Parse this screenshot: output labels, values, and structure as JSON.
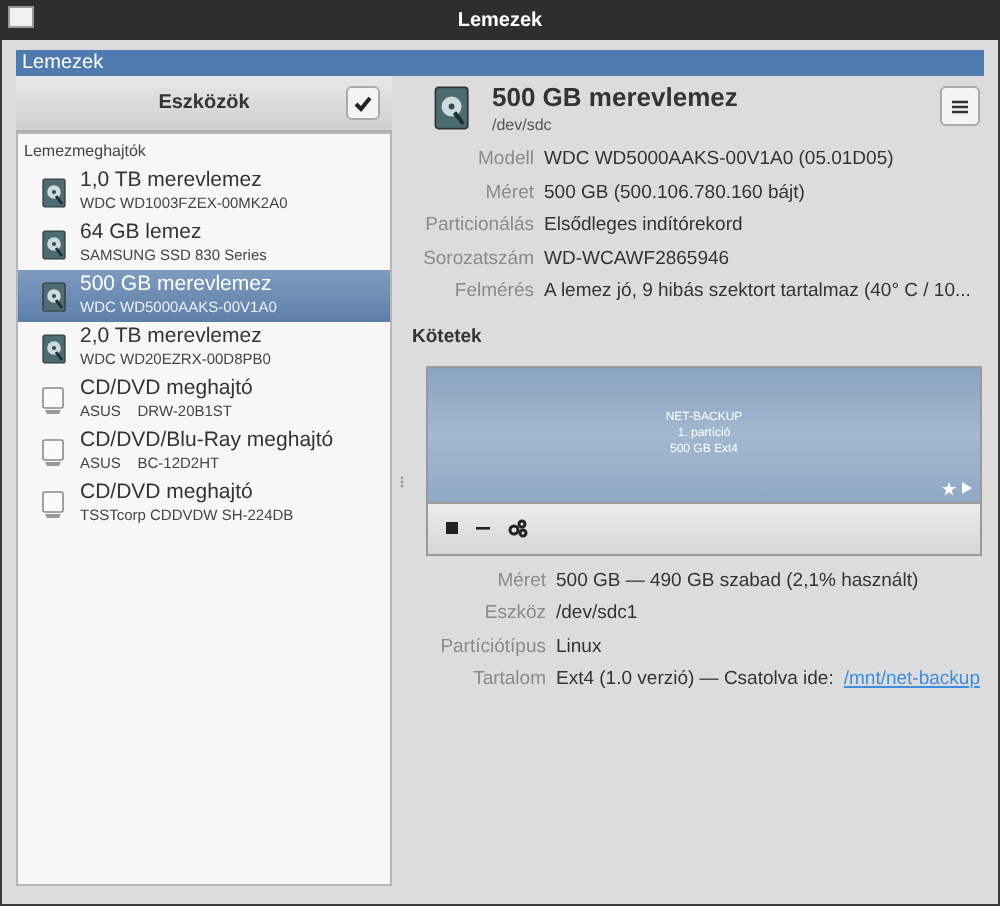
{
  "window": {
    "title": "Lemezek"
  },
  "header": {
    "title": "Lemezek"
  },
  "sidebar": {
    "title": "Eszközök",
    "section": "Lemezmeghajtók",
    "items": [
      {
        "kind": "disk",
        "name": "1,0 TB merevlemez",
        "model": "WDC WD1003FZEX-00MK2A0",
        "selected": false
      },
      {
        "kind": "disk",
        "name": "64 GB lemez",
        "model": "SAMSUNG SSD 830 Series",
        "selected": false
      },
      {
        "kind": "disk",
        "name": "500 GB merevlemez",
        "model": "WDC WD5000AAKS-00V1A0",
        "selected": true
      },
      {
        "kind": "disk",
        "name": "2,0 TB merevlemez",
        "model": "WDC WD20EZRX-00D8PB0",
        "selected": false
      },
      {
        "kind": "optical",
        "name": "CD/DVD meghajtó",
        "model": "ASUS    DRW-20B1ST",
        "selected": false
      },
      {
        "kind": "optical",
        "name": "CD/DVD/Blu-Ray meghajtó",
        "model": "ASUS    BC-12D2HT",
        "selected": false
      },
      {
        "kind": "optical",
        "name": "CD/DVD meghajtó",
        "model": "TSSTcorp CDDVDW SH-224DB",
        "selected": false
      }
    ]
  },
  "drive": {
    "name": "500 GB merevlemez",
    "device": "/dev/sdc",
    "properties": [
      {
        "label": "Modell",
        "value": "WDC WD5000AAKS-00V1A0 (05.01D05)"
      },
      {
        "label": "Méret",
        "value": "500 GB (500.106.780.160 bájt)"
      },
      {
        "label": "Particionálás",
        "value": "Elsődleges indítórekord"
      },
      {
        "label": "Sorozatszám",
        "value": "WD-WCAWF2865946"
      },
      {
        "label": "Felmérés",
        "value": "A lemez jó, 9 hibás szektort tartalmaz (40° C / 10..."
      }
    ]
  },
  "volumes": {
    "title": "Kötetek",
    "partition": {
      "lines": [
        "NET-BACKUP",
        "1. partíció",
        "500 GB Ext4"
      ]
    },
    "properties": [
      {
        "label": "Méret",
        "value": "500 GB — 490 GB szabad (2,1% használt)"
      },
      {
        "label": "Eszköz",
        "value": "/dev/sdc1"
      },
      {
        "label": "Partíciótípus",
        "value": "Linux"
      },
      {
        "label": "Tartalom",
        "value": "Ext4 (1.0 verzió) — Csatolva ide: ",
        "link": "/mnt/net-backup"
      }
    ]
  }
}
